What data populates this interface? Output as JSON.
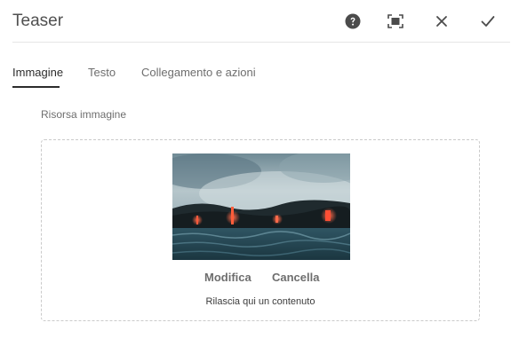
{
  "dialog": {
    "title": "Teaser",
    "header_icons": {
      "help": "help-circle-icon",
      "fullscreen": "fullscreen-icon",
      "cancel": "close-icon",
      "done": "checkmark-icon"
    }
  },
  "tabs": [
    {
      "label": "Immagine",
      "active": true
    },
    {
      "label": "Testo",
      "active": false
    },
    {
      "label": "Collegamento e azioni",
      "active": false
    }
  ],
  "image_field": {
    "label": "Risorsa immagine",
    "actions": {
      "edit": "Modifica",
      "clear": "Cancella"
    },
    "drop_hint": "Rilascia qui un contenuto"
  },
  "colors": {
    "text": "#4b4b4b",
    "active_tab_underline": "#2c2c2c",
    "dropzone_border": "#cacaca"
  }
}
